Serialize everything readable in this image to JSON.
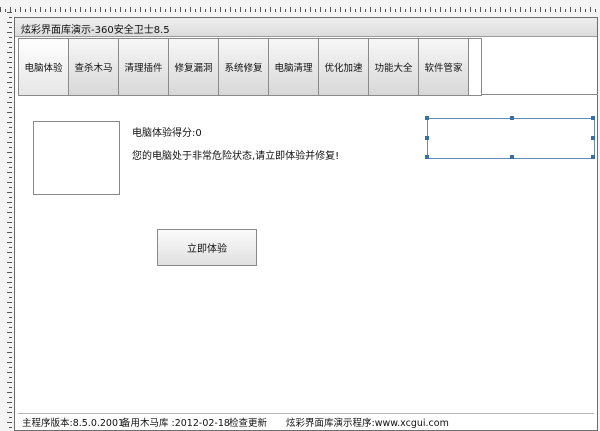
{
  "window": {
    "title": "炫彩界面库演示-360安全卫士8.5"
  },
  "toolbar": {
    "tabs": [
      "电脑体验",
      "查杀木马",
      "清理插件",
      "修复漏洞",
      "系统修复",
      "电脑清理",
      "优化加速",
      "功能大全",
      "软件管家"
    ]
  },
  "main": {
    "score_text": "电脑体验得分:0",
    "status_text": "您的电脑处于非常危险状态,请立即体验并修复!",
    "check_button": "立即体验"
  },
  "statusbar": {
    "version": "主程序版本:8.5.0.2001",
    "trojan_db": "备用木马库 :2012-02-18",
    "update": "检查更新",
    "demo": "炫彩界面库演示程序:www.xcgui.com"
  }
}
